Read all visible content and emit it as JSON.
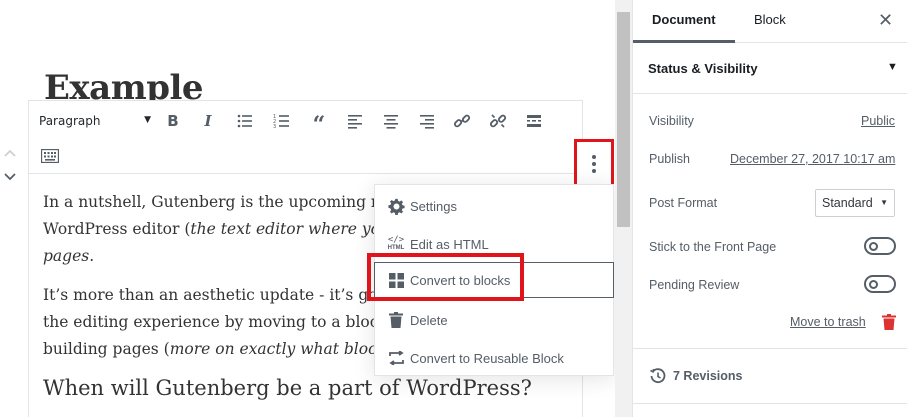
{
  "editor": {
    "post_title": "Example",
    "toolbar": {
      "block_type": "Paragraph"
    },
    "paragraph_1_plain": "In a nutshell, Gutenberg is the upcoming re",
    "paragraph_1_line2_plain": "WordPress editor (",
    "paragraph_1_line2_italic": "the text editor where you",
    "paragraph_1_line3_italic": "pages.",
    "paragraph_2_line1": "It’s more than an aesthetic update - it’s goi",
    "paragraph_2_line2": "the editing experience by moving to a block",
    "paragraph_2_line3_plain": "building pages (",
    "paragraph_2_line3_italic": "more on exactly what blocks",
    "heading": "When will Gutenberg be a part of WordPress?"
  },
  "menu": {
    "items": [
      {
        "label": "Settings",
        "icon": "gear-icon"
      },
      {
        "label": "Edit as HTML",
        "icon": "html-icon"
      },
      {
        "label": "Convert to blocks",
        "icon": "blocks-icon"
      },
      {
        "label": "Delete",
        "icon": "trash-icon"
      },
      {
        "label": "Convert to Reusable Block",
        "icon": "convert-icon"
      }
    ],
    "html_icon_text": "HTML"
  },
  "sidebar": {
    "tabs": [
      "Document",
      "Block"
    ],
    "close": "✕",
    "panel_title": "Status & Visibility",
    "visibility_label": "Visibility",
    "visibility_value": "Public",
    "publish_label": "Publish",
    "publish_value": "December 27, 2017 10:17 am",
    "post_format_label": "Post Format",
    "post_format_value": "Standard",
    "sticky_label": "Stick to the Front Page",
    "pending_label": "Pending Review",
    "trash_label": "Move to trash",
    "revisions_label": "7 Revisions"
  },
  "colors": {
    "highlight": "#e0151b",
    "trash": "#dc3232"
  }
}
